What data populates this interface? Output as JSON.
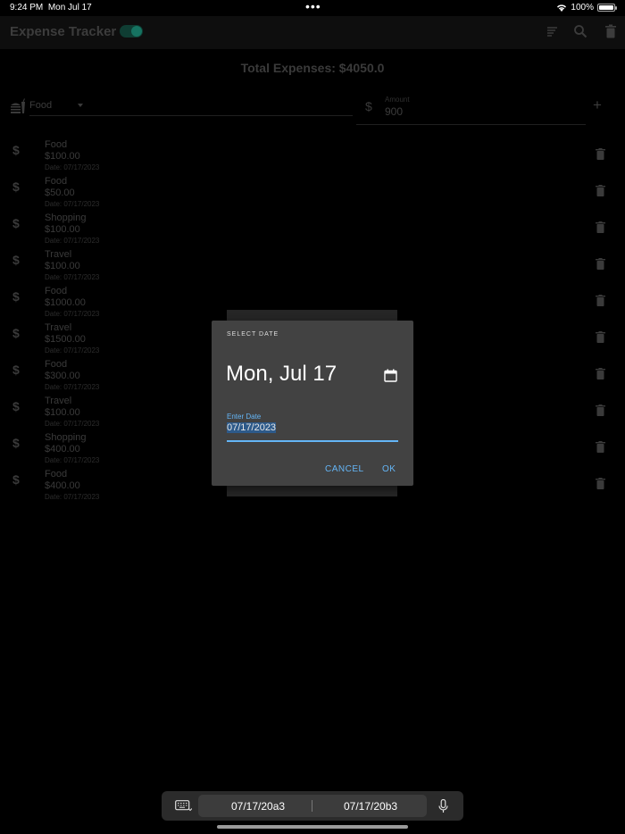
{
  "status_bar": {
    "time": "9:24 PM",
    "date": "Mon Jul 17",
    "battery": "100%",
    "dots": "•••"
  },
  "app_bar": {
    "title": "Expense Tracker",
    "toggle_on": true
  },
  "summary": {
    "total": "Total Expenses: $4050.0"
  },
  "form": {
    "category_value": "Food",
    "amount_label": "Amount",
    "amount_value": "900",
    "dollar": "$",
    "add": "+"
  },
  "expenses": [
    {
      "dollar": "$",
      "category": "Food",
      "amount": "$100.00",
      "date": "Date: 07/17/2023"
    },
    {
      "dollar": "$",
      "category": "Food",
      "amount": "$50.00",
      "date": "Date: 07/17/2023"
    },
    {
      "dollar": "$",
      "category": "Shopping",
      "amount": "$100.00",
      "date": "Date: 07/17/2023"
    },
    {
      "dollar": "$",
      "category": "Travel",
      "amount": "$100.00",
      "date": "Date: 07/17/2023"
    },
    {
      "dollar": "$",
      "category": "Food",
      "amount": "$1000.00",
      "date": "Date: 07/17/2023"
    },
    {
      "dollar": "$",
      "category": "Travel",
      "amount": "$1500.00",
      "date": "Date: 07/17/2023"
    },
    {
      "dollar": "$",
      "category": "Food",
      "amount": "$300.00",
      "date": "Date: 07/17/2023"
    },
    {
      "dollar": "$",
      "category": "Travel",
      "amount": "$100.00",
      "date": "Date: 07/17/2023"
    },
    {
      "dollar": "$",
      "category": "Shopping",
      "amount": "$400.00",
      "date": "Date: 07/17/2023"
    },
    {
      "dollar": "$",
      "category": "Food",
      "amount": "$400.00",
      "date": "Date: 07/17/2023"
    }
  ],
  "dialog": {
    "title": "SELECT DATE",
    "selected_date": "Mon, Jul 17",
    "input_label": "Enter Date",
    "input_value": "07/17/2023",
    "cancel": "CANCEL",
    "ok": "OK"
  },
  "keyboard_bar": {
    "suggestions": [
      "07/17/20a3",
      "07/17/20b3"
    ]
  },
  "colors": {
    "accent": "#64b5f6",
    "toggle": "#167361"
  }
}
